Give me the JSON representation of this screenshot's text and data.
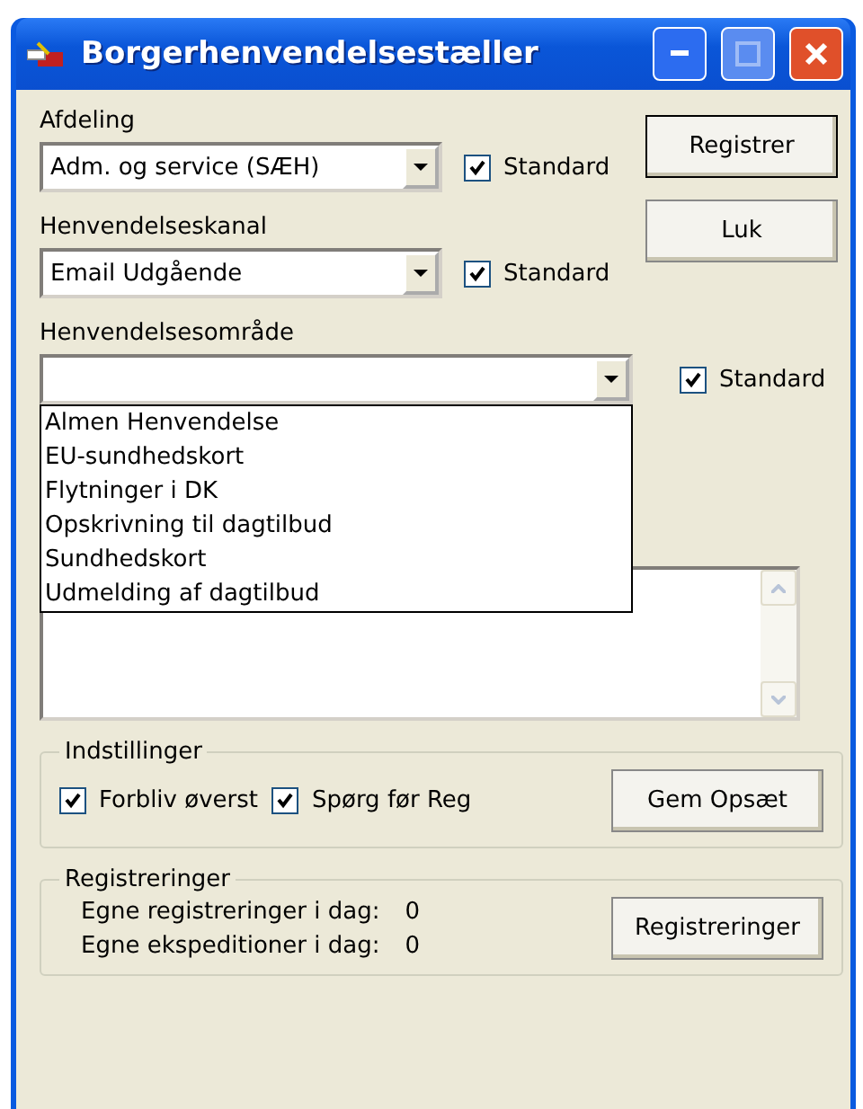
{
  "window": {
    "title": "Borgerhenvendelsestæller"
  },
  "fields": [
    {
      "label": "Afdeling",
      "value": "Adm. og service (SÆH)",
      "standard": {
        "label": "Standard",
        "checked": true
      }
    },
    {
      "label": "Henvendelseskanal",
      "value": "Email Udgående",
      "standard": {
        "label": "Standard",
        "checked": true
      }
    },
    {
      "label": "Henvendelsesområde",
      "standard": {
        "label": "Standard",
        "checked": true
      },
      "expanded": true,
      "options": [
        "Almen Henvendelse",
        "EU-sundhedskort",
        "Flytninger i DK",
        "Opskrivning til dagtilbud",
        "Sundhedskort",
        "Udmelding af dagtilbud"
      ]
    }
  ],
  "buttons": [
    "Registrer",
    "Luk"
  ],
  "settings": {
    "title": "Indstillinger",
    "checkboxes": [
      {
        "label": "Forbliv øverst",
        "checked": true
      },
      {
        "label": "Spørg før Reg",
        "checked": true
      }
    ],
    "button": "Gem Opsæt"
  },
  "registrations": {
    "title": "Registreringer",
    "rows": [
      {
        "label": "Egne registreringer i dag:",
        "value": "0"
      },
      {
        "label": "Egne ekspeditioner i dag:",
        "value": "0"
      }
    ],
    "button": "Registreringer"
  }
}
